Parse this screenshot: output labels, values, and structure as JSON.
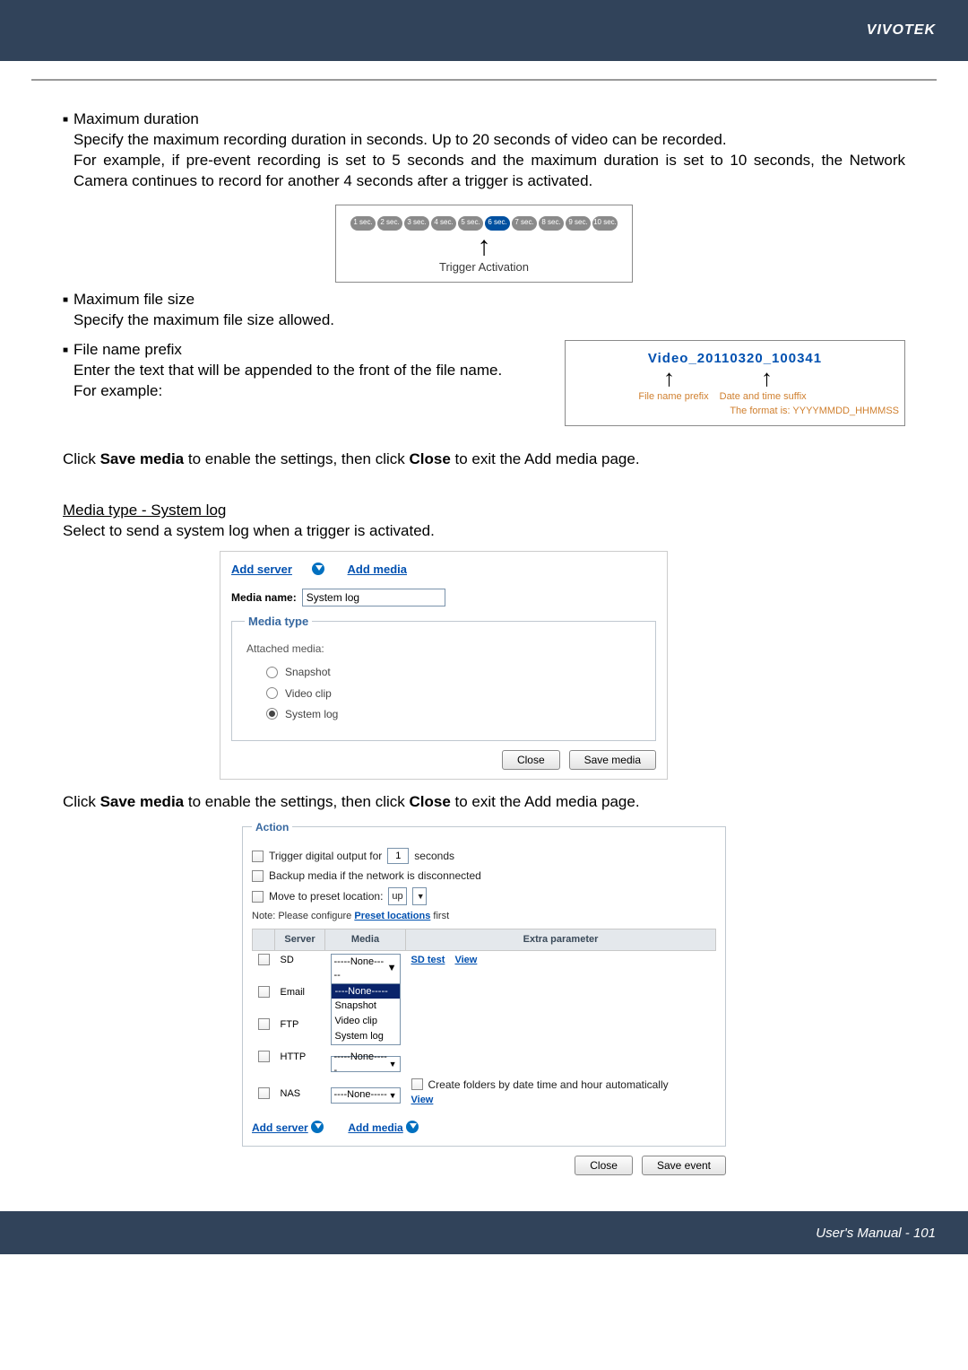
{
  "header": {
    "brand": "VIVOTEK"
  },
  "sec1": {
    "title": "Maximum duration",
    "line1": "Specify the maximum recording duration in seconds. Up to 20 seconds of video can be recorded.",
    "line2": "For example, if pre-event recording is set to 5 seconds and the maximum duration is set to 10 seconds, the Network Camera continues to record for another 4 seconds after a trigger is activated."
  },
  "timeline": {
    "pills": [
      "1 sec.",
      "2 sec.",
      "3 sec.",
      "4 sec.",
      "5 sec.",
      "6 sec.",
      "7 sec.",
      "8 sec.",
      "9 sec.",
      "10 sec."
    ],
    "active_index": 5,
    "caption": "Trigger Activation"
  },
  "sec2": {
    "title": "Maximum file size",
    "body": "Specify the maximum file size allowed."
  },
  "sec3": {
    "title": "File name prefix",
    "line1": "Enter the text that will be appended to the front of the file name.",
    "line2": " For example:"
  },
  "prefixbox": {
    "filename": "Video_20110320_100341",
    "label_prefix": "File name prefix",
    "label_suffix": "Date and time suffix",
    "format_line": "The format is: YYYYMMDD_HHMMSS"
  },
  "after1": {
    "pre": "Click ",
    "b1": "Save media",
    "mid": " to enable the settings, then click ",
    "b2": "Close",
    "post": " to exit the Add media page."
  },
  "sys": {
    "heading": "Media type - System log",
    "body": "Select to send a system log when a trigger is activated."
  },
  "mediapanel": {
    "tab_addserver": "Add server",
    "tab_addmedia": "Add media",
    "media_name_label": "Media name:",
    "media_name_value": "System log",
    "legend": "Media type",
    "attached": "Attached media:",
    "opt1": "Snapshot",
    "opt2": "Video clip",
    "opt3": "System log",
    "btn_close": "Close",
    "btn_save": "Save media"
  },
  "after2": {
    "pre": "Click ",
    "b1": "Save media",
    "mid": " to enable the settings, then click ",
    "b2": "Close",
    "post": " to exit the Add media page."
  },
  "action": {
    "legend": "Action",
    "row1a": "Trigger digital output for",
    "row1_val": "1",
    "row1b": "seconds",
    "row2": "Backup media if the network is disconnected",
    "row3a": "Move to preset location:",
    "row3_sel": "up",
    "note_a": "Note: Please configure ",
    "note_link": "Preset locations",
    "note_b": " first",
    "th_blank": "",
    "th_server": "Server",
    "th_media": "Media",
    "th_extra": "Extra parameter",
    "servers": [
      "SD",
      "Email",
      "FTP",
      "HTTP",
      "NAS"
    ],
    "none": "-----None-----",
    "none_short": "----None-----",
    "dropdown_opts": [
      "-----None-----",
      "Snapshot",
      "Video clip",
      "System log"
    ],
    "sd_links": {
      "a": "SD test",
      "b": "View"
    },
    "nas_text": "Create folders by date time and hour automatically",
    "nas_view": "View",
    "add_server": "Add server",
    "add_media": "Add media",
    "btn_close": "Close",
    "btn_save": "Save event"
  },
  "footer": {
    "label": "User's Manual - 101"
  }
}
